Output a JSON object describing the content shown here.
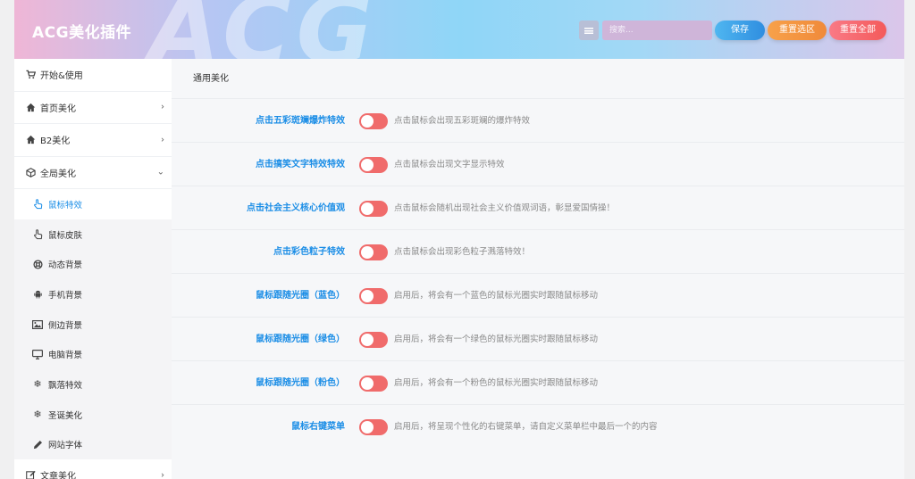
{
  "header": {
    "brand": "ACG美化插件",
    "watermark": "ACG",
    "search_placeholder": "搜索...",
    "save_label": "保存",
    "reset_section_label": "重置选区",
    "reset_all_label": "重置全部"
  },
  "sidebar": {
    "items": [
      {
        "label": "开始&使用",
        "icon": "cart-icon",
        "arrow": ""
      },
      {
        "label": "首页美化",
        "icon": "home-icon",
        "arrow": "›"
      },
      {
        "label": "B2美化",
        "icon": "home-icon",
        "arrow": "›"
      },
      {
        "label": "全局美化",
        "icon": "cube-icon",
        "arrow": "⌄"
      }
    ],
    "sub_items": [
      {
        "label": "鼠标特效",
        "icon": "pointer-hand-icon",
        "active": true
      },
      {
        "label": "鼠标皮肤",
        "icon": "pointer-hand-icon",
        "active": false
      },
      {
        "label": "动态背景",
        "icon": "lifebuoy-icon",
        "active": false
      },
      {
        "label": "手机背景",
        "icon": "android-icon",
        "active": false
      },
      {
        "label": "侧边背景",
        "icon": "image-icon",
        "active": false
      },
      {
        "label": "电脑背景",
        "icon": "monitor-icon",
        "active": false
      },
      {
        "label": "飘落特效",
        "icon": "snowflake-icon",
        "active": false
      },
      {
        "label": "圣诞美化",
        "icon": "snowflake-icon",
        "active": false
      },
      {
        "label": "网站字体",
        "icon": "pencil-icon",
        "active": false
      }
    ],
    "bottom_item": {
      "label": "文章美化",
      "icon": "edit-icon",
      "arrow": "›"
    }
  },
  "main": {
    "section_title": "通用美化",
    "rows": [
      {
        "label": "点击五彩斑斓爆炸特效",
        "desc": "点击鼠标会出现五彩斑斓的爆炸特效",
        "enabled": false
      },
      {
        "label": "点击搞笑文字特效特效",
        "desc": "点击鼠标会出现文字显示特效",
        "enabled": false
      },
      {
        "label": "点击社会主义核心价值观",
        "desc": "点击鼠标会随机出现社会主义价值观词语，彰显爱国情操！",
        "enabled": false
      },
      {
        "label": "点击彩色粒子特效",
        "desc": "点击鼠标会出现彩色粒子溅落特效！",
        "enabled": false
      },
      {
        "label": "鼠标跟随光圈（蓝色）",
        "desc": "启用后，将会有一个蓝色的鼠标光圈实时跟随鼠标移动",
        "enabled": false
      },
      {
        "label": "鼠标跟随光圈（绿色）",
        "desc": "启用后，将会有一个绿色的鼠标光圈实时跟随鼠标移动",
        "enabled": false
      },
      {
        "label": "鼠标跟随光圈（粉色）",
        "desc": "启用后，将会有一个粉色的鼠标光圈实时跟随鼠标移动",
        "enabled": false
      },
      {
        "label": "鼠标右键菜单",
        "desc": "启用后，将呈现个性化的右键菜单，请自定义菜单栏中最后一个的内容",
        "enabled": false
      }
    ]
  },
  "colors": {
    "accent": "#1a8de6",
    "toggle_off": "#f06b6b",
    "save": "#2f8ee0",
    "reset_section": "#f08a3a",
    "reset_all": "#f45a5a"
  }
}
